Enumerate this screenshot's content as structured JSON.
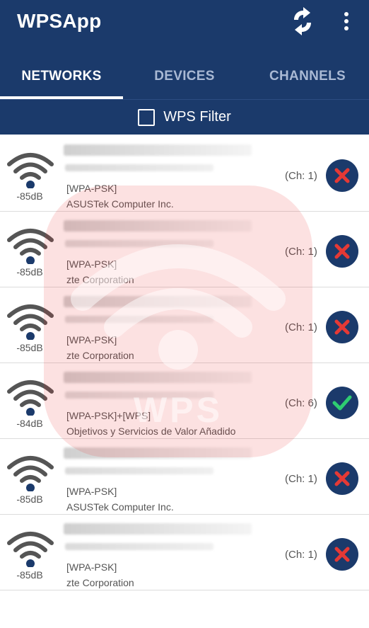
{
  "app": {
    "title": "WPSApp"
  },
  "icons": {
    "refresh": "refresh-icon",
    "menu": "more-vert-icon",
    "wifi": "wifi-signal-icon",
    "fail": "close-icon",
    "ok": "check-icon"
  },
  "colors": {
    "primary": "#1b3a6b",
    "fail": "#e53935",
    "ok": "#2ecc71",
    "watermark": "#ec2828"
  },
  "tabs": [
    {
      "label": "NETWORKS",
      "active": true
    },
    {
      "label": "DEVICES",
      "active": false
    },
    {
      "label": "CHANNELS",
      "active": false
    }
  ],
  "filter": {
    "label": "WPS Filter",
    "checked": false
  },
  "watermark": {
    "text": "WPS"
  },
  "networks": [
    {
      "signal": "-85dB",
      "security": "[WPA-PSK]",
      "vendor": "ASUSTek Computer Inc.",
      "channel": "(Ch: 1)",
      "status": "fail"
    },
    {
      "signal": "-85dB",
      "security": "[WPA-PSK]",
      "vendor": "zte Corporation",
      "channel": "(Ch: 1)",
      "status": "fail"
    },
    {
      "signal": "-85dB",
      "security": "[WPA-PSK]",
      "vendor": "zte Corporation",
      "channel": "(Ch: 1)",
      "status": "fail"
    },
    {
      "signal": "-84dB",
      "security": "[WPA-PSK]+[WPS]",
      "vendor": "Objetivos y Servicios de Valor Añadido",
      "channel": "(Ch: 6)",
      "status": "ok"
    },
    {
      "signal": "-85dB",
      "security": "[WPA-PSK]",
      "vendor": "ASUSTek Computer Inc.",
      "channel": "(Ch: 1)",
      "status": "fail"
    },
    {
      "signal": "-85dB",
      "security": "[WPA-PSK]",
      "vendor": "zte Corporation",
      "channel": "(Ch: 1)",
      "status": "fail"
    }
  ]
}
